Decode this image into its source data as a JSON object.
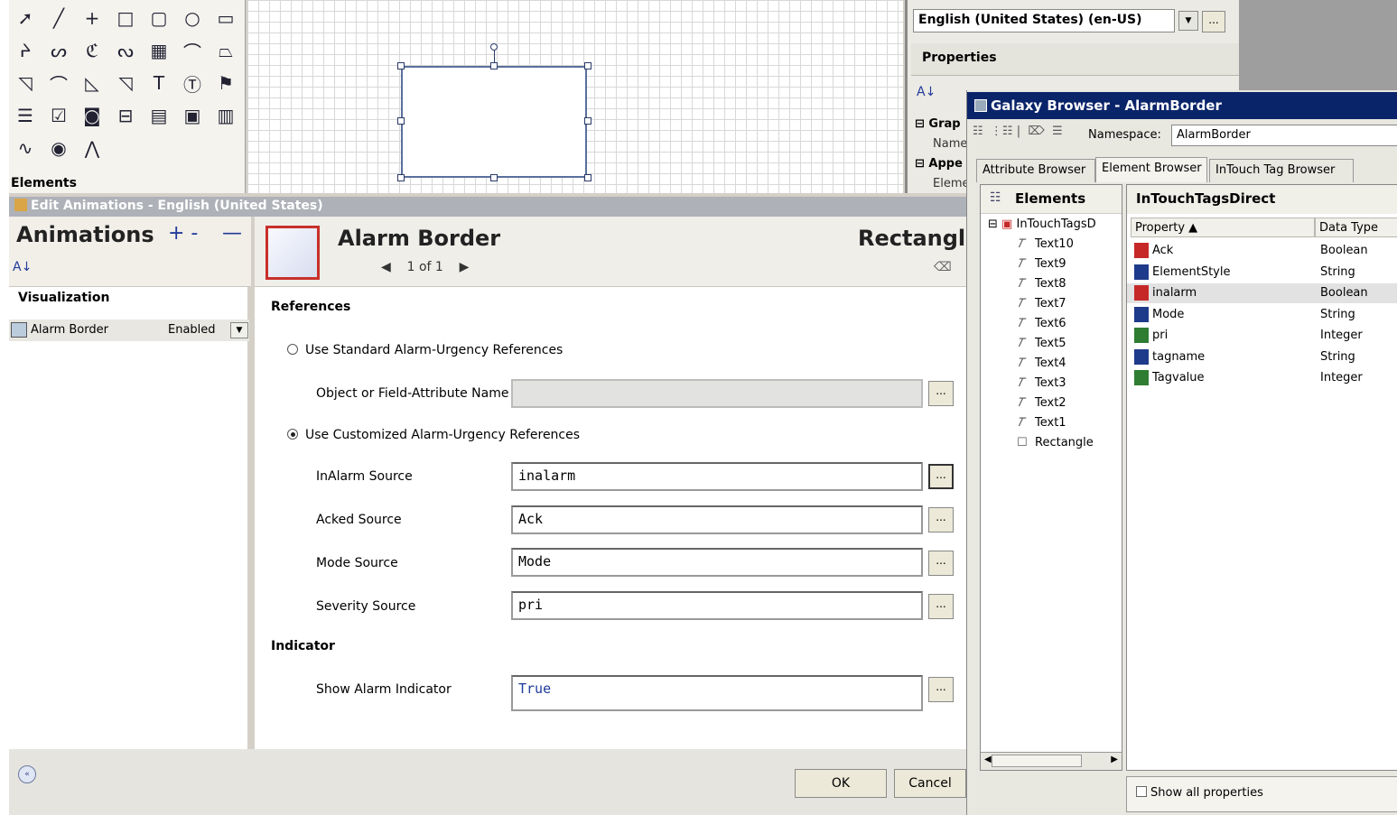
{
  "toolbox": {
    "section_label": "Elements",
    "tools": [
      "pointer-icon",
      "line-icon",
      "crosshair-icon",
      "rectangle-icon",
      "rounded-rectangle-icon",
      "ellipse-icon",
      "rounded-square-icon",
      "polyline-icon",
      "curve-icon",
      "closed-curve-icon",
      "freeform-icon",
      "image-icon",
      "arc-icon",
      "polygon-icon",
      "pie-icon",
      "chord-icon",
      "polygon-outline-icon",
      "wedge-icon",
      "text-icon",
      "textbox-icon",
      "status-icon",
      "list-icon",
      "checkbox-icon",
      "radio-icon",
      "combo-icon",
      "calendar-icon",
      "datetime-icon",
      "listbox-icon",
      "trend-icon",
      "embedded-icon",
      "curve-chart-icon"
    ]
  },
  "properties_panel": {
    "language_value": "English (United States) (en-US)",
    "ellipsis": "...",
    "title": "Properties",
    "sort_icon": "A↓",
    "rows": [
      "Grap",
      "Name",
      "Appe",
      "Eleme"
    ]
  },
  "edit_animations": {
    "window_title": "Edit Animations - English (United States)",
    "heading": "Animations",
    "add_glyph": "+ -",
    "remove_glyph": "—",
    "sort_glyph": "A↓",
    "visualization_label": "Visualization",
    "animation_item": {
      "name": "Alarm Border",
      "state": "Enabled"
    },
    "element_title": "Alarm Border",
    "pager": "1 of 1",
    "element_type": "Rectangl",
    "references_label": "References",
    "radio_standard": "Use Standard Alarm-Urgency References",
    "object_field_label": "Object or Field-Attribute Name",
    "object_field_value": "",
    "radio_customized": "Use Customized Alarm-Urgency References",
    "fields": [
      {
        "label": "InAlarm Source",
        "value": "inalarm"
      },
      {
        "label": "Acked Source",
        "value": "Ack"
      },
      {
        "label": "Mode Source",
        "value": "Mode"
      },
      {
        "label": "Severity Source",
        "value": "pri"
      }
    ],
    "indicator_label": "Indicator",
    "show_indicator_label": "Show Alarm Indicator",
    "show_indicator_value": "True",
    "ellipsis": "...",
    "ok_label": "OK",
    "cancel_label": "Cancel",
    "collapse_glyph": "«"
  },
  "galaxy_browser": {
    "title": "Galaxy Browser - AlarmBorder",
    "namespace_label": "Namespace:",
    "namespace_value": "AlarmBorder",
    "tabs": [
      "Attribute Browser",
      "Element Browser",
      "InTouch Tag Browser"
    ],
    "active_tab": "Element Browser",
    "tree_header": "Elements",
    "tree_root": "InTouchTagsD",
    "tree_items": [
      "Text10",
      "Text9",
      "Text8",
      "Text7",
      "Text6",
      "Text5",
      "Text4",
      "Text3",
      "Text2",
      "Text1",
      "Rectangle"
    ],
    "props_title": "InTouchTagsDirect",
    "col_property": "Property ▲",
    "col_type": "Data Type",
    "properties": [
      {
        "name": "Ack",
        "type": "Boolean",
        "icon": "boolean-icon",
        "color": "#c62828"
      },
      {
        "name": "ElementStyle",
        "type": "String",
        "icon": "string-icon",
        "color": "#1e3a8a"
      },
      {
        "name": "inalarm",
        "type": "Boolean",
        "icon": "boolean-icon",
        "color": "#c62828"
      },
      {
        "name": "Mode",
        "type": "String",
        "icon": "string-icon",
        "color": "#1e3a8a"
      },
      {
        "name": "pri",
        "type": "Integer",
        "icon": "integer-icon",
        "color": "#2e7d32"
      },
      {
        "name": "tagname",
        "type": "String",
        "icon": "string-icon",
        "color": "#1e3a8a"
      },
      {
        "name": "Tagvalue",
        "type": "Integer",
        "icon": "integer-icon",
        "color": "#2e7d32"
      }
    ],
    "selected_property": "inalarm",
    "show_all_label": "Show all properties"
  }
}
